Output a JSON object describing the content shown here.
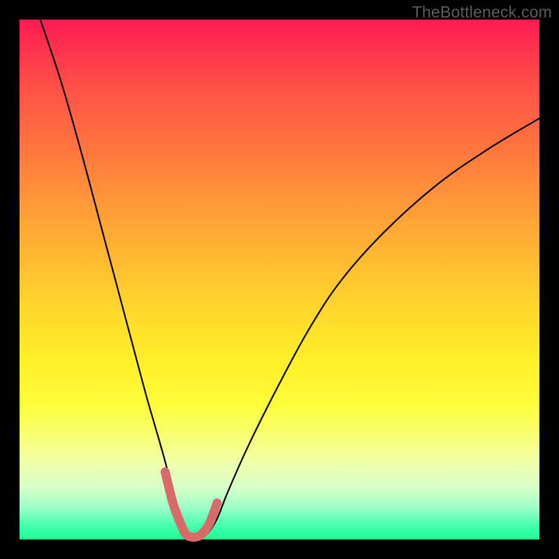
{
  "watermark": "TheBottleneck.com",
  "chart_data": {
    "type": "line",
    "title": "",
    "xlabel": "",
    "ylabel": "",
    "xlim": [
      0,
      100
    ],
    "ylim": [
      0,
      100
    ],
    "series": [
      {
        "name": "bottleneck-curve",
        "x": [
          4,
          8,
          12,
          16,
          20,
          24,
          26,
          28,
          30,
          31,
          32,
          33,
          34,
          36,
          38,
          40,
          44,
          50,
          56,
          62,
          70,
          80,
          90,
          100
        ],
        "values": [
          100,
          88,
          74,
          59,
          44,
          29,
          22,
          15,
          7,
          3,
          1,
          0.5,
          0.5,
          1,
          4,
          9,
          18,
          30,
          41,
          50,
          59,
          68,
          75,
          81
        ]
      }
    ],
    "highlight_segment": {
      "name": "optimal-range",
      "x": [
        28,
        29.5,
        31,
        32,
        33,
        34,
        35,
        36.5,
        38
      ],
      "values": [
        13,
        7,
        3,
        1,
        0.5,
        0.5,
        1,
        3,
        7
      ]
    },
    "colors": {
      "curve": "#000000",
      "highlight": "#d86a6a",
      "background_top": "#ff1a52",
      "background_bottom": "#19ff94"
    }
  }
}
